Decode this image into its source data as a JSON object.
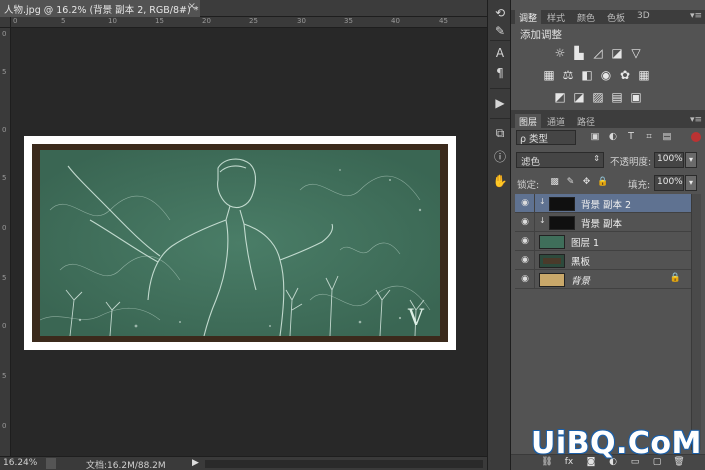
{
  "document": {
    "tab_title": "人物.jpg @ 16.2% (背景 副本 2, RGB/8#) *",
    "close_glyph": "×"
  },
  "rulers": {
    "top_marks": [
      "0",
      "5",
      "10",
      "15",
      "20",
      "25",
      "30",
      "35",
      "40",
      "45"
    ],
    "left_marks": [
      "0",
      "5",
      "0",
      "5",
      "0",
      "5",
      "0",
      "5",
      "0"
    ]
  },
  "status": {
    "zoom": "16.24%",
    "doc_info": "文档:16.2M/88.2M",
    "arrow": "▶"
  },
  "canvas": {
    "artwork_letter": "V",
    "board_color": "#3b2a1c",
    "chalk_color": "#3f6e5a"
  },
  "icon_strip": {
    "icons": [
      "history-icon",
      "brush-icon",
      "character-icon",
      "paragraph-icon",
      "play-icon",
      "clone-icon",
      "info-icon",
      "puppet-icon"
    ]
  },
  "adjust_panel": {
    "tabs": [
      "调整",
      "样式",
      "颜色",
      "色板",
      "3D"
    ],
    "menu_glyph": "▾≡",
    "title": "添加调整"
  },
  "layers_panel": {
    "tabs": [
      "图层",
      "通道",
      "路径"
    ],
    "menu_glyph": "▾≡",
    "kind_filter": "ρ 类型",
    "blend_mode": "滤色",
    "opacity_label": "不透明度:",
    "opacity_value": "100%",
    "lock_label": "锁定:",
    "fill_label": "填充:",
    "fill_value": "100%",
    "layers": [
      {
        "name": "背景 副本 2",
        "selected": true,
        "clipped": true
      },
      {
        "name": "背景 副本",
        "selected": false,
        "clipped": true
      },
      {
        "name": "图层 1",
        "selected": false,
        "clipped": false
      },
      {
        "name": "黑板",
        "selected": false,
        "clipped": false
      },
      {
        "name": "背景",
        "selected": false,
        "clipped": false,
        "locked": true
      }
    ]
  },
  "watermark": "UiBQ.CoM"
}
